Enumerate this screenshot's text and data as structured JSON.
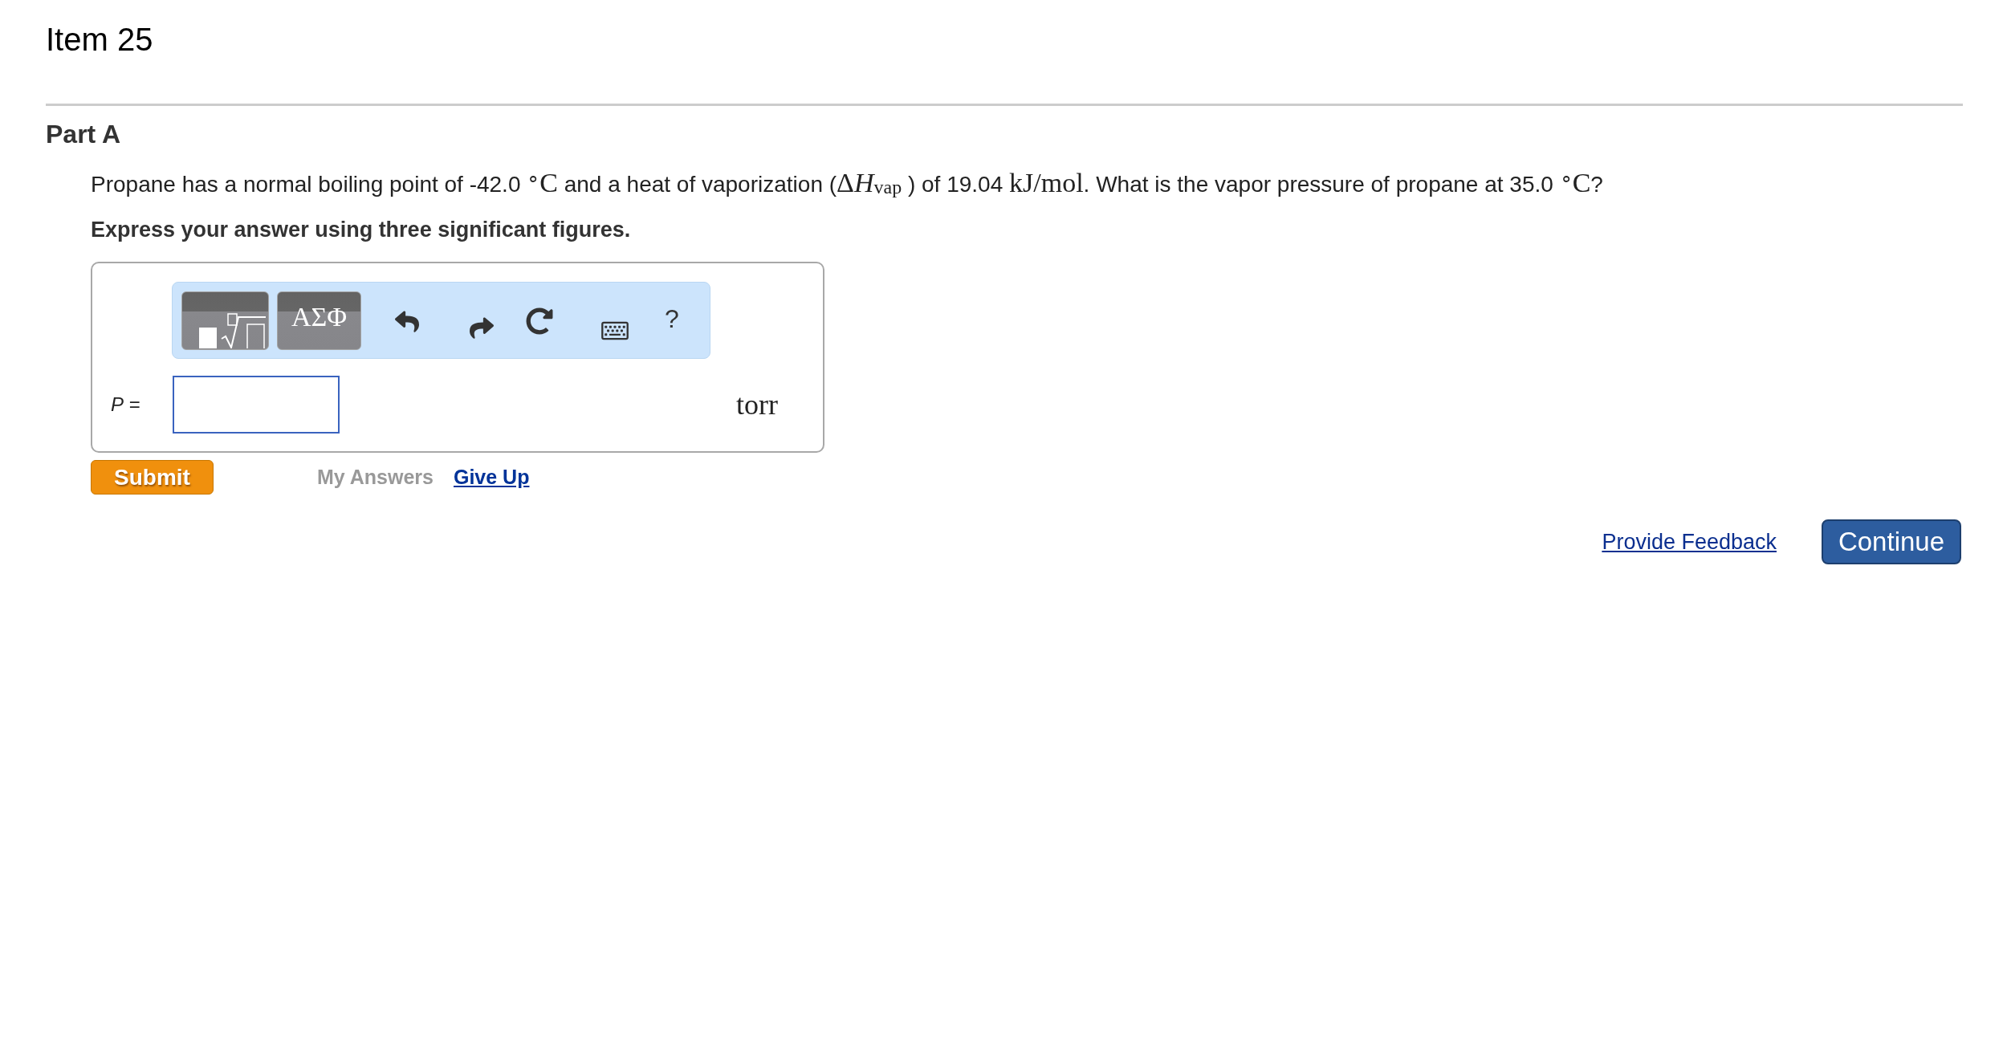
{
  "header": {
    "title": "Item 25"
  },
  "part": {
    "title": "Part A",
    "question": [
      {
        "kind": "text",
        "text": "Propane has a normal boiling point of -42.0 "
      },
      {
        "kind": "math",
        "text": "$^{∘}$C"
      },
      {
        "kind": "text",
        "text": " and a heat of vaporization ("
      },
      {
        "kind": "math",
        "text": "Δ"
      },
      {
        "kind": "math",
        "text": "*H*"
      },
      {
        "kind": "math",
        "text": "$_{vap}$"
      },
      {
        "kind": "text",
        "text": " ) of 19.04 "
      },
      {
        "kind": "math",
        "text": "kJ/mol"
      },
      {
        "kind": "text",
        "text": ". What is the vapor pressure of propane at 35.0 "
      },
      {
        "kind": "math",
        "text": "$^{∘}$C"
      },
      {
        "kind": "text",
        "text": "?"
      }
    ],
    "instruction": "Express your answer using three significant figures.",
    "answer": {
      "toolbar": [
        {
          "kind": "templates"
        },
        {
          "kind": "symbols",
          "label": "ΑΣΦ"
        },
        {
          "kind": "undo"
        },
        {
          "kind": "redo"
        },
        {
          "kind": "reset"
        },
        {
          "kind": "keyboard"
        },
        {
          "kind": "help",
          "label": "?"
        }
      ],
      "label": "*P* =",
      "unit": "torr"
    },
    "actions": {
      "submit": "Submit",
      "my_answers": {
        "label": "My Answers",
        "disabled": true
      },
      "give_up": "Give Up"
    }
  },
  "footer": {
    "feedback_link": "Provide Feedback",
    "continue": "Continue"
  }
}
